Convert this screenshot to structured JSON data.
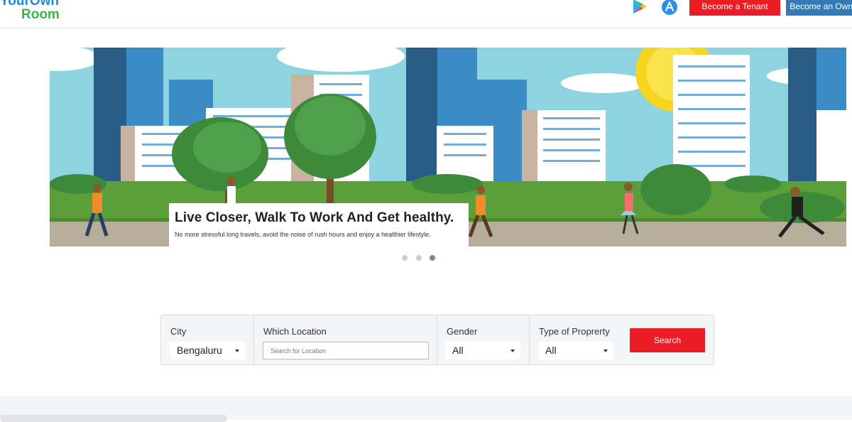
{
  "header": {
    "logo": {
      "line1": "YourOwn",
      "line2": "Room"
    },
    "icons": [
      "google-play-icon",
      "app-store-icon"
    ],
    "buttons": {
      "tenant": "Become a Tenant",
      "owner": "Become an Owner"
    },
    "colors": {
      "tenant_button": "#ec1c24",
      "owner_button": "#337ab7"
    }
  },
  "banner": {
    "title": "Live Closer, Walk To Work And Get healthy.",
    "subtitle": "No more stressful long travels, avoid the noise of rush hours and enjoy a healthier lifestyle.",
    "slides": 3,
    "active_slide": 3
  },
  "search": {
    "city": {
      "label": "City",
      "value": "Bengaluru"
    },
    "location": {
      "label": "Which Location",
      "placeholder": "Search for Location"
    },
    "gender": {
      "label": "Gender",
      "value": "All"
    },
    "property": {
      "label": "Type of Proprerty",
      "value": "All"
    },
    "button": "Search",
    "colors": {
      "button": "#ec1c24"
    }
  }
}
